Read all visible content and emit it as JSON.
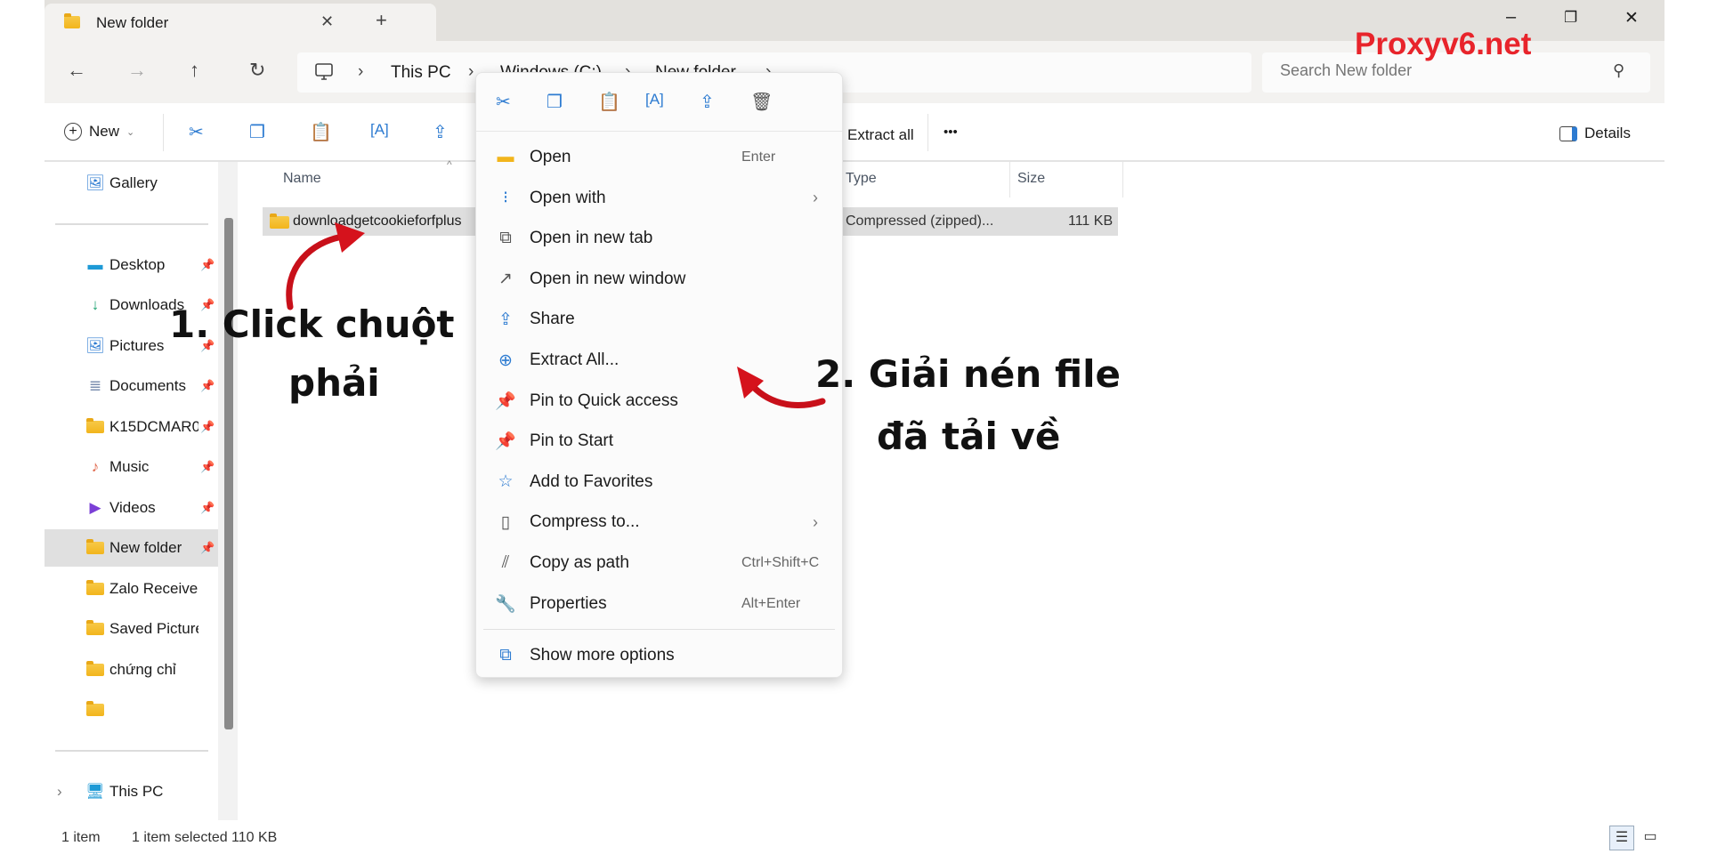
{
  "window": {
    "tab_title": "New folder",
    "new_tab": "+",
    "minimize": "–",
    "restore": "❐",
    "close": "✕"
  },
  "nav": {
    "back": "←",
    "forward": "→",
    "up": "↑",
    "refresh": "↻"
  },
  "address": {
    "segments": [
      "This PC",
      "Windows (C:)",
      "New folder"
    ],
    "separator": "›"
  },
  "search": {
    "placeholder": "Search New folder"
  },
  "watermark": "Proxyv6.net",
  "toolbar": {
    "new_label": "New",
    "extract_all": "Extract all",
    "more": "•••",
    "details": "Details"
  },
  "sidebar": {
    "items": [
      {
        "label": "Gallery",
        "icon": "gallery-icon"
      },
      {
        "label": "Desktop",
        "icon": "desktop-icon",
        "pinned": true
      },
      {
        "label": "Downloads",
        "icon": "download-icon",
        "pinned": true
      },
      {
        "label": "Pictures",
        "icon": "pictures-icon",
        "pinned": true
      },
      {
        "label": "Documents",
        "icon": "documents-icon",
        "pinned": true
      },
      {
        "label": "K15DCMAR0",
        "icon": "folder-icon",
        "pinned": true
      },
      {
        "label": "Music",
        "icon": "music-icon",
        "pinned": true
      },
      {
        "label": "Videos",
        "icon": "videos-icon",
        "pinned": true
      },
      {
        "label": "New folder",
        "icon": "folder-icon",
        "pinned": true,
        "selected": true
      },
      {
        "label": "Zalo Received Fil",
        "icon": "folder-icon"
      },
      {
        "label": "Saved Pictures",
        "icon": "folder-icon"
      },
      {
        "label": "chứng chỉ",
        "icon": "folder-icon"
      },
      {
        "label": "",
        "icon": "folder-icon"
      },
      {
        "label": "This PC",
        "icon": "this-pc-icon"
      }
    ]
  },
  "columns": {
    "name": "Name",
    "type": "Type",
    "size": "Size"
  },
  "file": {
    "name": "downloadgetcookieforfplus",
    "type": "Compressed (zipped)...",
    "size": "111 KB"
  },
  "status": {
    "count": "1 item",
    "selected": "1 item selected  110 KB"
  },
  "context_menu": {
    "top_icons": [
      "cut-icon",
      "copy-icon",
      "paste-icon",
      "rename-icon",
      "share-icon",
      "delete-icon"
    ],
    "items": [
      {
        "label": "Open",
        "shortcut": "Enter"
      },
      {
        "label": "Open with",
        "submenu": true
      },
      {
        "label": "Open in new tab"
      },
      {
        "label": "Open in new window"
      },
      {
        "label": "Share"
      },
      {
        "label": "Extract All..."
      },
      {
        "label": "Pin to Quick access"
      },
      {
        "label": "Pin to Start"
      },
      {
        "label": "Add to Favorites"
      },
      {
        "label": "Compress to...",
        "submenu": true
      },
      {
        "label": "Copy as path",
        "shortcut": "Ctrl+Shift+C"
      },
      {
        "label": "Properties",
        "shortcut": "Alt+Enter"
      }
    ],
    "more": "Show more options",
    "chevron": "›"
  },
  "annotations": {
    "step1_line1": "1.  Click chuột",
    "step1_line2": "phải",
    "step2_line1": "2. Giải nén file",
    "step2_line2": "đã tải về"
  },
  "colors": {
    "accent": "#2d7bd1",
    "annotation_arrow": "#c8101a",
    "watermark": "#e8242b"
  }
}
